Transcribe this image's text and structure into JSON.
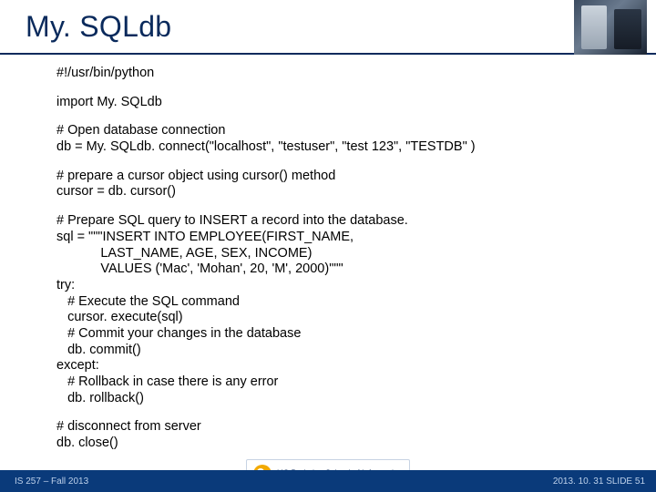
{
  "title": "My. SQLdb",
  "code": {
    "l1": "#!/usr/bin/python",
    "l2": "import My. SQLdb",
    "l3": "# Open database connection",
    "l4": "db = My. SQLdb. connect(\"localhost\", \"testuser\", \"test 123\", \"TESTDB\" )",
    "l5": "# prepare a cursor object using cursor() method",
    "l6": "cursor = db. cursor()",
    "l7": "# Prepare SQL query to INSERT a record into the database.",
    "l8": "sql = \"\"\"INSERT INTO EMPLOYEE(FIRST_NAME,",
    "l9": "            LAST_NAME, AGE, SEX, INCOME)",
    "l10": "            VALUES ('Mac', 'Mohan', 20, 'M', 2000)\"\"\"",
    "l11": "try:",
    "l12": "   # Execute the SQL command",
    "l13": "   cursor. execute(sql)",
    "l14": "   # Commit your changes in the database",
    "l15": "   db. commit()",
    "l16": "except:",
    "l17": "   # Rollback in case there is any error",
    "l18": "   db. rollback()",
    "l19": "# disconnect from server",
    "l20": "db. close()"
  },
  "footer": {
    "left": "IS 257 – Fall 2013",
    "right": "2013. 10. 31 SLIDE 51",
    "logo_line1": "UC Berkeley School of Information"
  }
}
